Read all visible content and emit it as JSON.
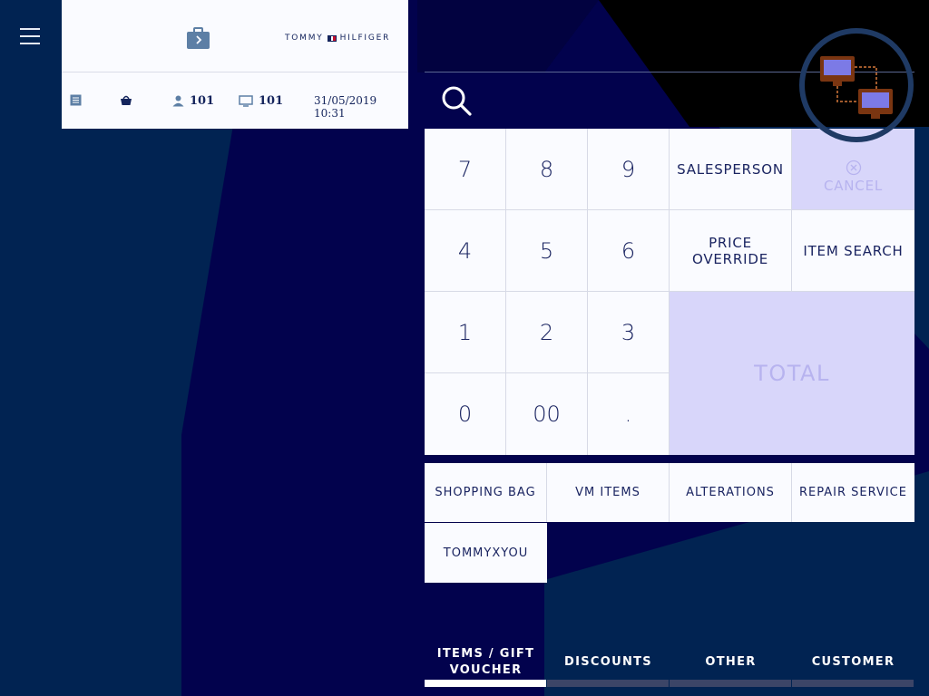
{
  "menu": {
    "icon": "hamburger-icon"
  },
  "header": {
    "bag_icon": "briefcase-arrow-icon",
    "brand": "TOMMY HILFIGER",
    "brand_left": "TOMMY",
    "brand_right": "HILFIGER"
  },
  "status": {
    "receipt_icon": "document-icon",
    "basket_icon": "shopping-basket-icon",
    "user_icon": "person-icon",
    "user_value": "101",
    "terminal_icon": "monitor-icon",
    "terminal_value": "101",
    "datetime": "31/05/2019 10:31"
  },
  "search": {
    "icon": "search-icon"
  },
  "keypad": {
    "keys": {
      "k7": "7",
      "k8": "8",
      "k9": "9",
      "k4": "4",
      "k5": "5",
      "k6": "6",
      "k1": "1",
      "k2": "2",
      "k3": "3",
      "k0": "0",
      "k00": "00",
      "kdot": "."
    },
    "salesperson": "SALESPERSON",
    "cancel": "CANCEL",
    "price_override": "PRICE OVERRIDE",
    "item_search": "ITEM SEARCH",
    "total": "TOTAL"
  },
  "quick_buttons": [
    "SHOPPING BAG",
    "VM ITEMS",
    "ALTERATIONS",
    "REPAIR SERVICE",
    "TOMMYXYOU"
  ],
  "tabs": [
    {
      "label": "ITEMS / GIFT VOUCHER",
      "active": true
    },
    {
      "label": "DISCOUNTS",
      "active": false
    },
    {
      "label": "OTHER",
      "active": false
    },
    {
      "label": "CUSTOMER",
      "active": false
    }
  ],
  "overlay": {
    "icon": "network-computers-icon"
  },
  "colors": {
    "background_dark": "#012352",
    "background_navy": "#02024d",
    "panel": "#fafbff",
    "accent_disabled": "#d8d6fa",
    "text": "#1a2461"
  }
}
